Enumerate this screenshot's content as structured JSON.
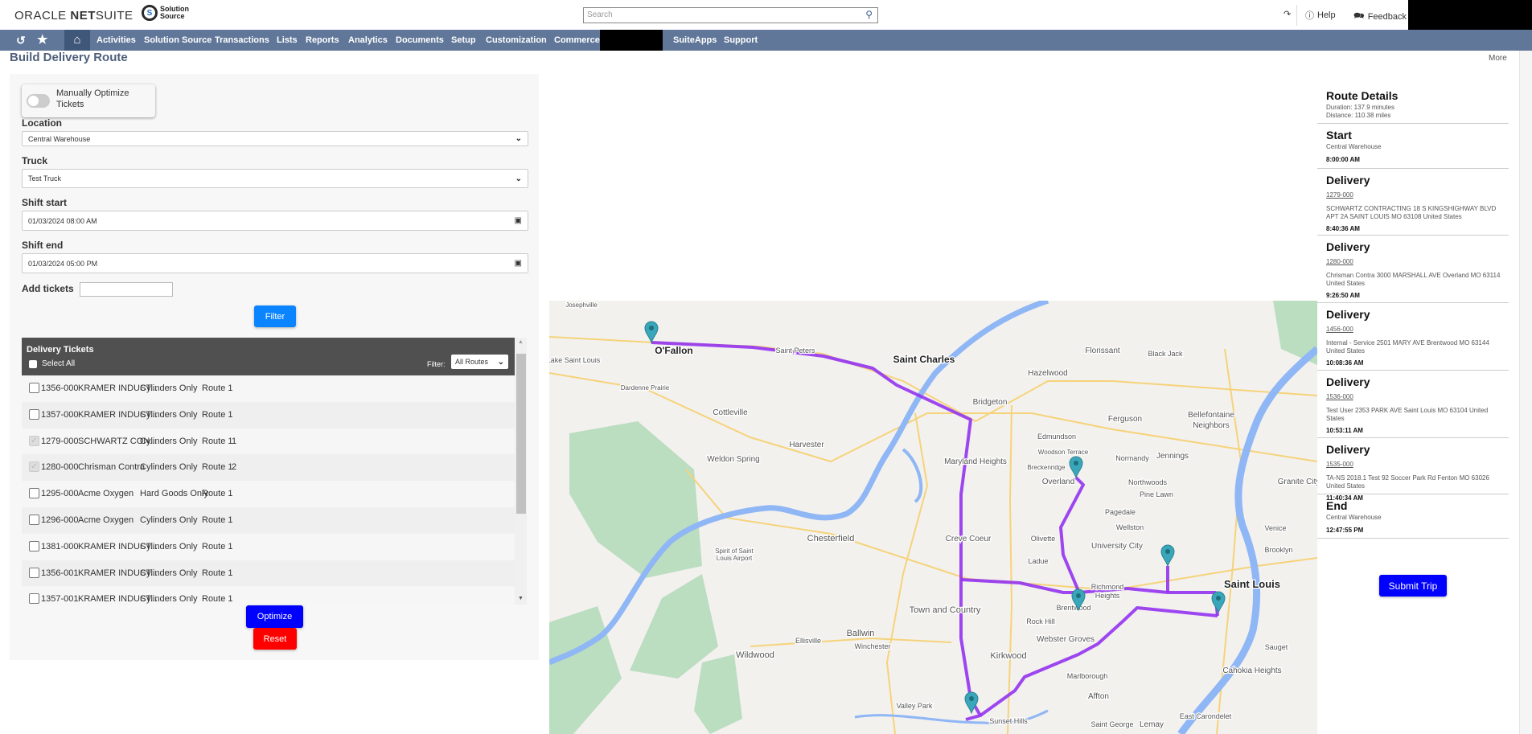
{
  "header": {
    "brand": "ORACLE NETSUITE",
    "brand_a": "ORACLE ",
    "brand_b": "NET",
    "brand_c": "SUITE",
    "partner_logo": "Solution Source",
    "partner_line1": "Solution",
    "partner_line2": "Source",
    "search_placeholder": "Search",
    "help": "Help",
    "feedback": "Feedback"
  },
  "nav": {
    "items": [
      "Activities",
      "Solution Source",
      "Transactions",
      "Lists",
      "Reports",
      "Analytics",
      "Documents",
      "Setup",
      "Customization",
      "Commerce",
      "SuiteApps",
      "Support"
    ]
  },
  "page": {
    "title": "Build Delivery Route",
    "more": "More"
  },
  "form": {
    "toggle_label": "Manually Optimize Tickets",
    "toggle_on": false,
    "location_label": "Location",
    "location_value": "Central Warehouse",
    "truck_label": "Truck",
    "truck_value": "Test Truck",
    "shift_start_label": "Shift start",
    "shift_start_value": "01/03/2024 08:00 AM",
    "shift_end_label": "Shift end",
    "shift_end_value": "01/03/2024 05:00 PM",
    "add_tickets_label": "Add tickets",
    "add_tickets_value": "",
    "filter_button": "Filter"
  },
  "tickets": {
    "title": "Delivery Tickets",
    "select_all": "Select All",
    "filter_label": "Filter:",
    "filter_value": "All Routes",
    "rows": [
      {
        "id": "1356-000",
        "customer": "KRAMER INDUST...",
        "type": "Cylinders Only",
        "route": "Route 1",
        "seq": "",
        "checked": false
      },
      {
        "id": "1357-000",
        "customer": "KRAMER INDUST...",
        "type": "Cylinders Only",
        "route": "Route 1",
        "seq": "",
        "checked": false
      },
      {
        "id": "1279-000",
        "customer": "SCHWARTZ CON...",
        "type": "Cylinders Only",
        "route": "Route 1",
        "seq": "1",
        "checked": true
      },
      {
        "id": "1280-000",
        "customer": "Chrisman Contra",
        "type": "Cylinders Only",
        "route": "Route 1",
        "seq": "2",
        "checked": true
      },
      {
        "id": "1295-000",
        "customer": "Acme Oxygen",
        "type": "Hard Goods Only",
        "route": "Route 1",
        "seq": "",
        "checked": false
      },
      {
        "id": "1296-000",
        "customer": "Acme Oxygen",
        "type": "Cylinders Only",
        "route": "Route 1",
        "seq": "",
        "checked": false
      },
      {
        "id": "1381-000",
        "customer": "KRAMER INDUST...",
        "type": "Cylinders Only",
        "route": "Route 1",
        "seq": "",
        "checked": false
      },
      {
        "id": "1356-001",
        "customer": "KRAMER INDUST...",
        "type": "Cylinders Only",
        "route": "Route 1",
        "seq": "",
        "checked": false
      },
      {
        "id": "1357-001",
        "customer": "KRAMER INDUST...",
        "type": "Cylinders Only",
        "route": "Route 1",
        "seq": "",
        "checked": false
      }
    ],
    "optimize_button": "Optimize",
    "reset_button": "Reset"
  },
  "route_details": {
    "title": "Route Details",
    "duration": "Duration: 137.9 minutes",
    "distance": "Distance: 110.38 miles",
    "stops": [
      {
        "kind": "Start",
        "ticket": "",
        "address": "Central Warehouse",
        "time": "8:00:00 AM"
      },
      {
        "kind": "Delivery",
        "ticket": "1279-000",
        "address": "SCHWARTZ CONTRACTING 18 S KINGSHIGHWAY BLVD APT 2A SAINT LOUIS MO 63108 United States",
        "time": "8:40:36 AM"
      },
      {
        "kind": "Delivery",
        "ticket": "1280-000",
        "address": "Chrisman Contra 3000 MARSHALL AVE Overland MO 63114 United States",
        "time": "9:26:50 AM"
      },
      {
        "kind": "Delivery",
        "ticket": "1456-000",
        "address": "Internal - Service 2501 MARY AVE Brentwood MO 63144 United States",
        "time": "10:08:36 AM"
      },
      {
        "kind": "Delivery",
        "ticket": "1536-000",
        "address": "Test User 2353 PARK AVE Saint Louis MO 63104 United States",
        "time": "10:53:11 AM"
      },
      {
        "kind": "Delivery",
        "ticket": "1535-000",
        "address": "TA-NS 2018.1 Test 92 Soccer Park Rd Fenton MO 63026 United States",
        "time": "11:40:34 AM"
      },
      {
        "kind": "End",
        "ticket": "",
        "address": "Central Warehouse",
        "time": "12:47:55 PM"
      }
    ],
    "submit_button": "Submit Trip"
  },
  "map": {
    "route_color": "#9433f0",
    "pin_color": "#3aa6b9",
    "water_color": "#8fb6f5",
    "park_color": "#a8d5b0",
    "labels": [
      "Josephville",
      "O'Fallon",
      "Lake Saint Louis",
      "Saint Peters",
      "Saint Charles",
      "Florissant",
      "Black Jack",
      "Hazelwood",
      "Dardenne Prairie",
      "Bridgeton",
      "Cottleville",
      "Ferguson",
      "Bellefontaine",
      "Neighbors",
      "Edmundson",
      "Harvester",
      "Woodson Terrace",
      "Weldon Spring",
      "Normandy",
      "Jennings",
      "Maryland Heights",
      "Breckenridge",
      "Overland",
      "Northwoods",
      "Granite City",
      "Pine Lawn",
      "Pagedale",
      "Wellston",
      "Venice",
      "Chesterfield",
      "Creve Coeur",
      "Olivette",
      "University City",
      "Brooklyn",
      "Ladue",
      "Saint Louis",
      "Richmond",
      "Heights",
      "Brentwood",
      "Town and Country",
      "Rock Hill",
      "Ballwin",
      "Webster Groves",
      "Ellisville",
      "Winchester",
      "Sauget",
      "Wildwood",
      "Kirkwood",
      "Cahokia Heights",
      "Marlborough",
      "Affton",
      "Valley Park",
      "Sunset Hills",
      "Saint George",
      "Lemay",
      "East Carondelet",
      "Spirit of Saint",
      "Louis Airport"
    ]
  },
  "colors": {
    "nav": "#607799",
    "filter_button": "#0a84ff",
    "optimize_button": "#0000ff",
    "reset_button": "#ff0000",
    "submit_button": "#0000ff",
    "tickets_header": "#505050"
  }
}
